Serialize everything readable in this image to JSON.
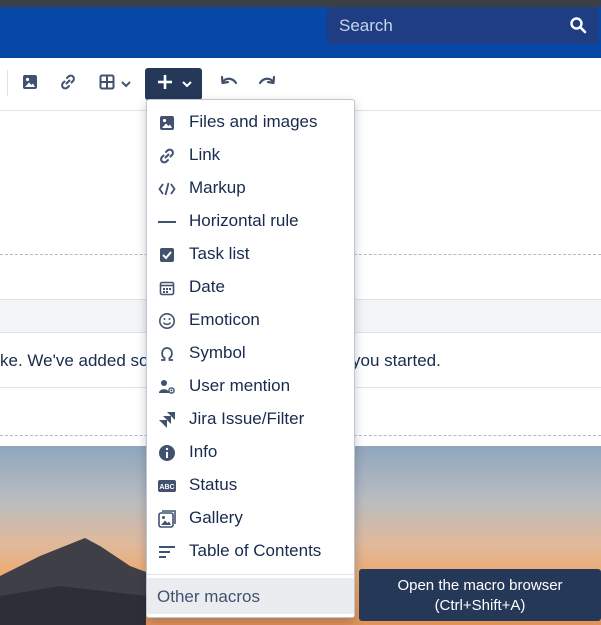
{
  "header": {
    "search": {
      "placeholder": "Search",
      "icon": "search-icon"
    }
  },
  "toolbar": {
    "buttons": [
      {
        "name": "image",
        "icon": "image-icon"
      },
      {
        "name": "link",
        "icon": "link-icon"
      },
      {
        "name": "table",
        "icon": "table-icon"
      },
      {
        "name": "insert",
        "icon": "plus-icon",
        "active": true
      },
      {
        "name": "undo",
        "icon": "undo-icon"
      },
      {
        "name": "redo",
        "icon": "redo-icon"
      }
    ]
  },
  "editor": {
    "text_left": "ke. We've added so",
    "text_right": "you started."
  },
  "insert_menu": {
    "items": [
      {
        "label": "Files and images",
        "icon": "image-icon"
      },
      {
        "label": "Link",
        "icon": "link-icon"
      },
      {
        "label": "Markup",
        "icon": "code-icon"
      },
      {
        "label": "Horizontal rule",
        "icon": "horizontal-rule-icon"
      },
      {
        "label": "Task list",
        "icon": "checkbox-icon"
      },
      {
        "label": "Date",
        "icon": "calendar-icon"
      },
      {
        "label": "Emoticon",
        "icon": "smiley-icon"
      },
      {
        "label": "Symbol",
        "icon": "omega-icon"
      },
      {
        "label": "User mention",
        "icon": "user-mention-icon"
      },
      {
        "label": "Jira Issue/Filter",
        "icon": "jira-icon"
      },
      {
        "label": "Info",
        "icon": "info-icon"
      },
      {
        "label": "Status",
        "icon": "status-icon"
      },
      {
        "label": "Gallery",
        "icon": "gallery-icon"
      },
      {
        "label": "Table of Contents",
        "icon": "toc-icon"
      }
    ],
    "other_macros": "Other macros"
  },
  "tooltip": {
    "line1": "Open the macro browser",
    "line2": "(Ctrl+Shift+A)"
  },
  "colors": {
    "header": "#0747a6",
    "active_button": "#253858",
    "tooltip": "#253858"
  }
}
